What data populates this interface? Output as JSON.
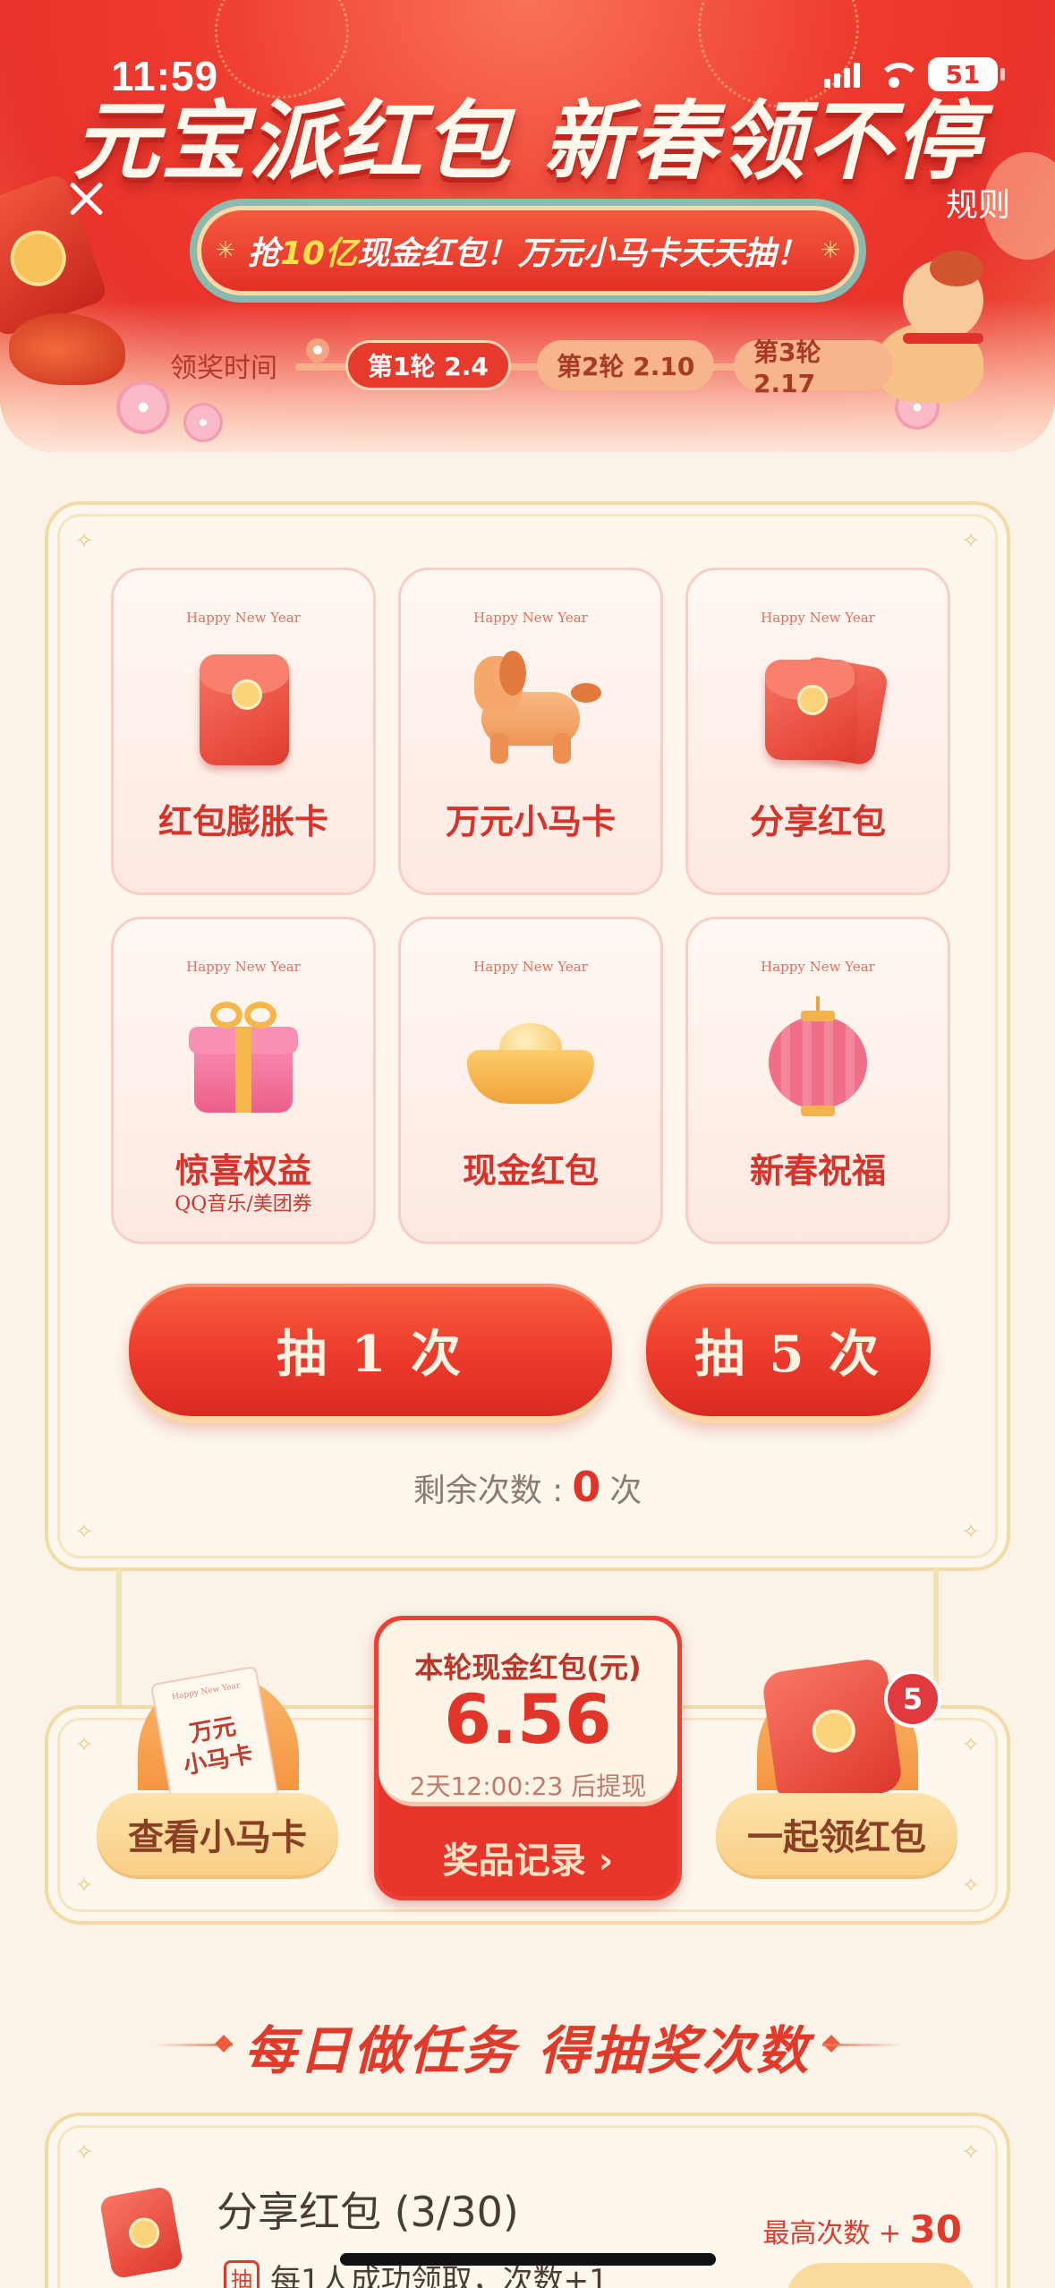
{
  "status_bar": {
    "time": "11:59",
    "battery": "51"
  },
  "header": {
    "title": "元宝派红包 新春领不停",
    "rules": "规则",
    "banner": {
      "prefix": "抢",
      "highlight": "10亿",
      "suffix": "现金红包！万元小马卡天天抽！"
    },
    "timeline_label": "领奖时间",
    "rounds": [
      {
        "label": "第1轮 2.4",
        "active": true
      },
      {
        "label": "第2轮 2.10",
        "active": false
      },
      {
        "label": "第3轮 2.17",
        "active": false
      }
    ]
  },
  "prizes": [
    {
      "tag": "Happy New Year",
      "name": "红包膨胀卡",
      "sub": "",
      "icon": "red-envelope-icon"
    },
    {
      "tag": "Happy New Year",
      "name": "万元小马卡",
      "sub": "",
      "icon": "horse-icon"
    },
    {
      "tag": "Happy New Year",
      "name": "分享红包",
      "sub": "",
      "icon": "double-envelope-icon"
    },
    {
      "tag": "Happy New Year",
      "name": "惊喜权益",
      "sub": "QQ音乐/美团券",
      "icon": "gift-box-icon"
    },
    {
      "tag": "Happy New Year",
      "name": "现金红包",
      "sub": "",
      "icon": "gold-ingot-icon"
    },
    {
      "tag": "Happy New Year",
      "name": "新春祝福",
      "sub": "",
      "icon": "lantern-icon"
    }
  ],
  "draw": {
    "once": "抽 1 次",
    "five": "抽 5 次",
    "remaining_prefix": "剩余次数 :",
    "remaining_count": "0",
    "remaining_suffix": "次"
  },
  "pool": {
    "title": "本轮现金红包(元)",
    "amount": "6.56",
    "timer": "2天12:00:23 后提现",
    "record_link": "奖品记录 ›"
  },
  "left_action": {
    "card_tiny": "Happy New Year",
    "card_text_1": "万元",
    "card_text_2": "小马卡",
    "label": "查看小马卡"
  },
  "right_action": {
    "label": "一起领红包",
    "badge": "5"
  },
  "tasks_section": {
    "title": "每日做任务  得抽奖次数",
    "items": [
      {
        "title": "分享红包 (3/30)",
        "max_prefix": "最高次数 + ",
        "max_value": "30",
        "tag": "抽",
        "desc": "每1人成功领取，次数+1"
      }
    ]
  },
  "colors": {
    "primary_red": "#e8332c",
    "gold": "#f6b74a",
    "cream": "#fbf3e8"
  }
}
